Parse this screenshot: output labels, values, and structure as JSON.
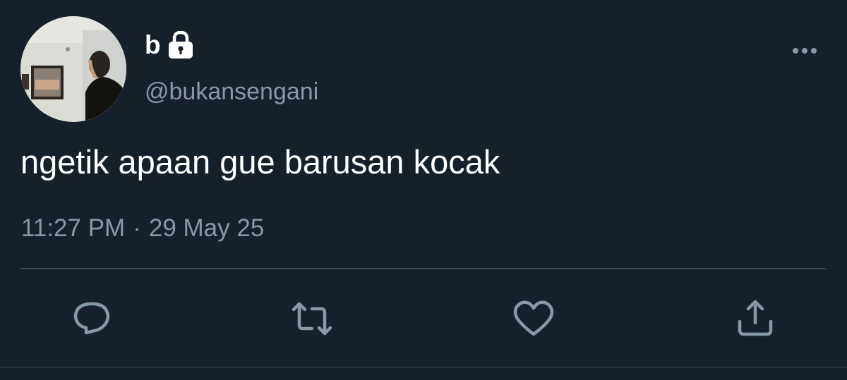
{
  "user": {
    "display_name": "b",
    "handle": "@bukansengani",
    "protected": true,
    "avatar_icon": "avatar-photo"
  },
  "tweet": {
    "text": "ngetik apaan gue barusan kocak",
    "time": "11:27 PM",
    "separator": "·",
    "date": "29 May 25"
  },
  "actions": [
    {
      "icon": "reply-icon"
    },
    {
      "icon": "retweet-icon"
    },
    {
      "icon": "like-icon"
    },
    {
      "icon": "share-icon"
    }
  ],
  "colors": {
    "background": "#15202b",
    "primary_text": "#ffffff",
    "secondary_text": "#8899a6",
    "divider": "#38444d"
  }
}
